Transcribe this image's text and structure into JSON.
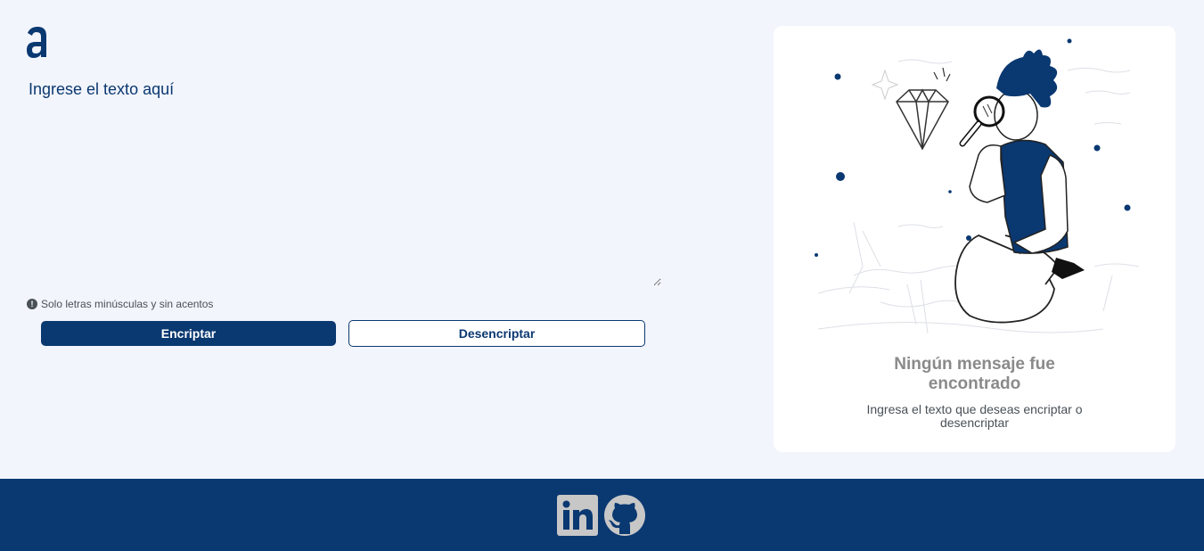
{
  "app": {
    "logo_icon": "alura-a-logo-icon",
    "brand_color": "#0a3871"
  },
  "input": {
    "placeholder": "Ingrese el texto aquí",
    "value": ""
  },
  "hint": {
    "icon": "exclamation-circle-icon",
    "text": "Solo letras minúsculas y sin acentos"
  },
  "buttons": {
    "encrypt_label": "Encriptar",
    "decrypt_label": "Desencriptar"
  },
  "result": {
    "title": "Ningún mensaje fue encontrado",
    "subtitle": "Ingresa el texto que deseas encriptar o desencriptar",
    "illustration": "person-with-magnifying-glass-and-diamond"
  },
  "footer": {
    "icons": [
      "linkedin-icon",
      "github-icon"
    ],
    "background": "#0a3871"
  }
}
